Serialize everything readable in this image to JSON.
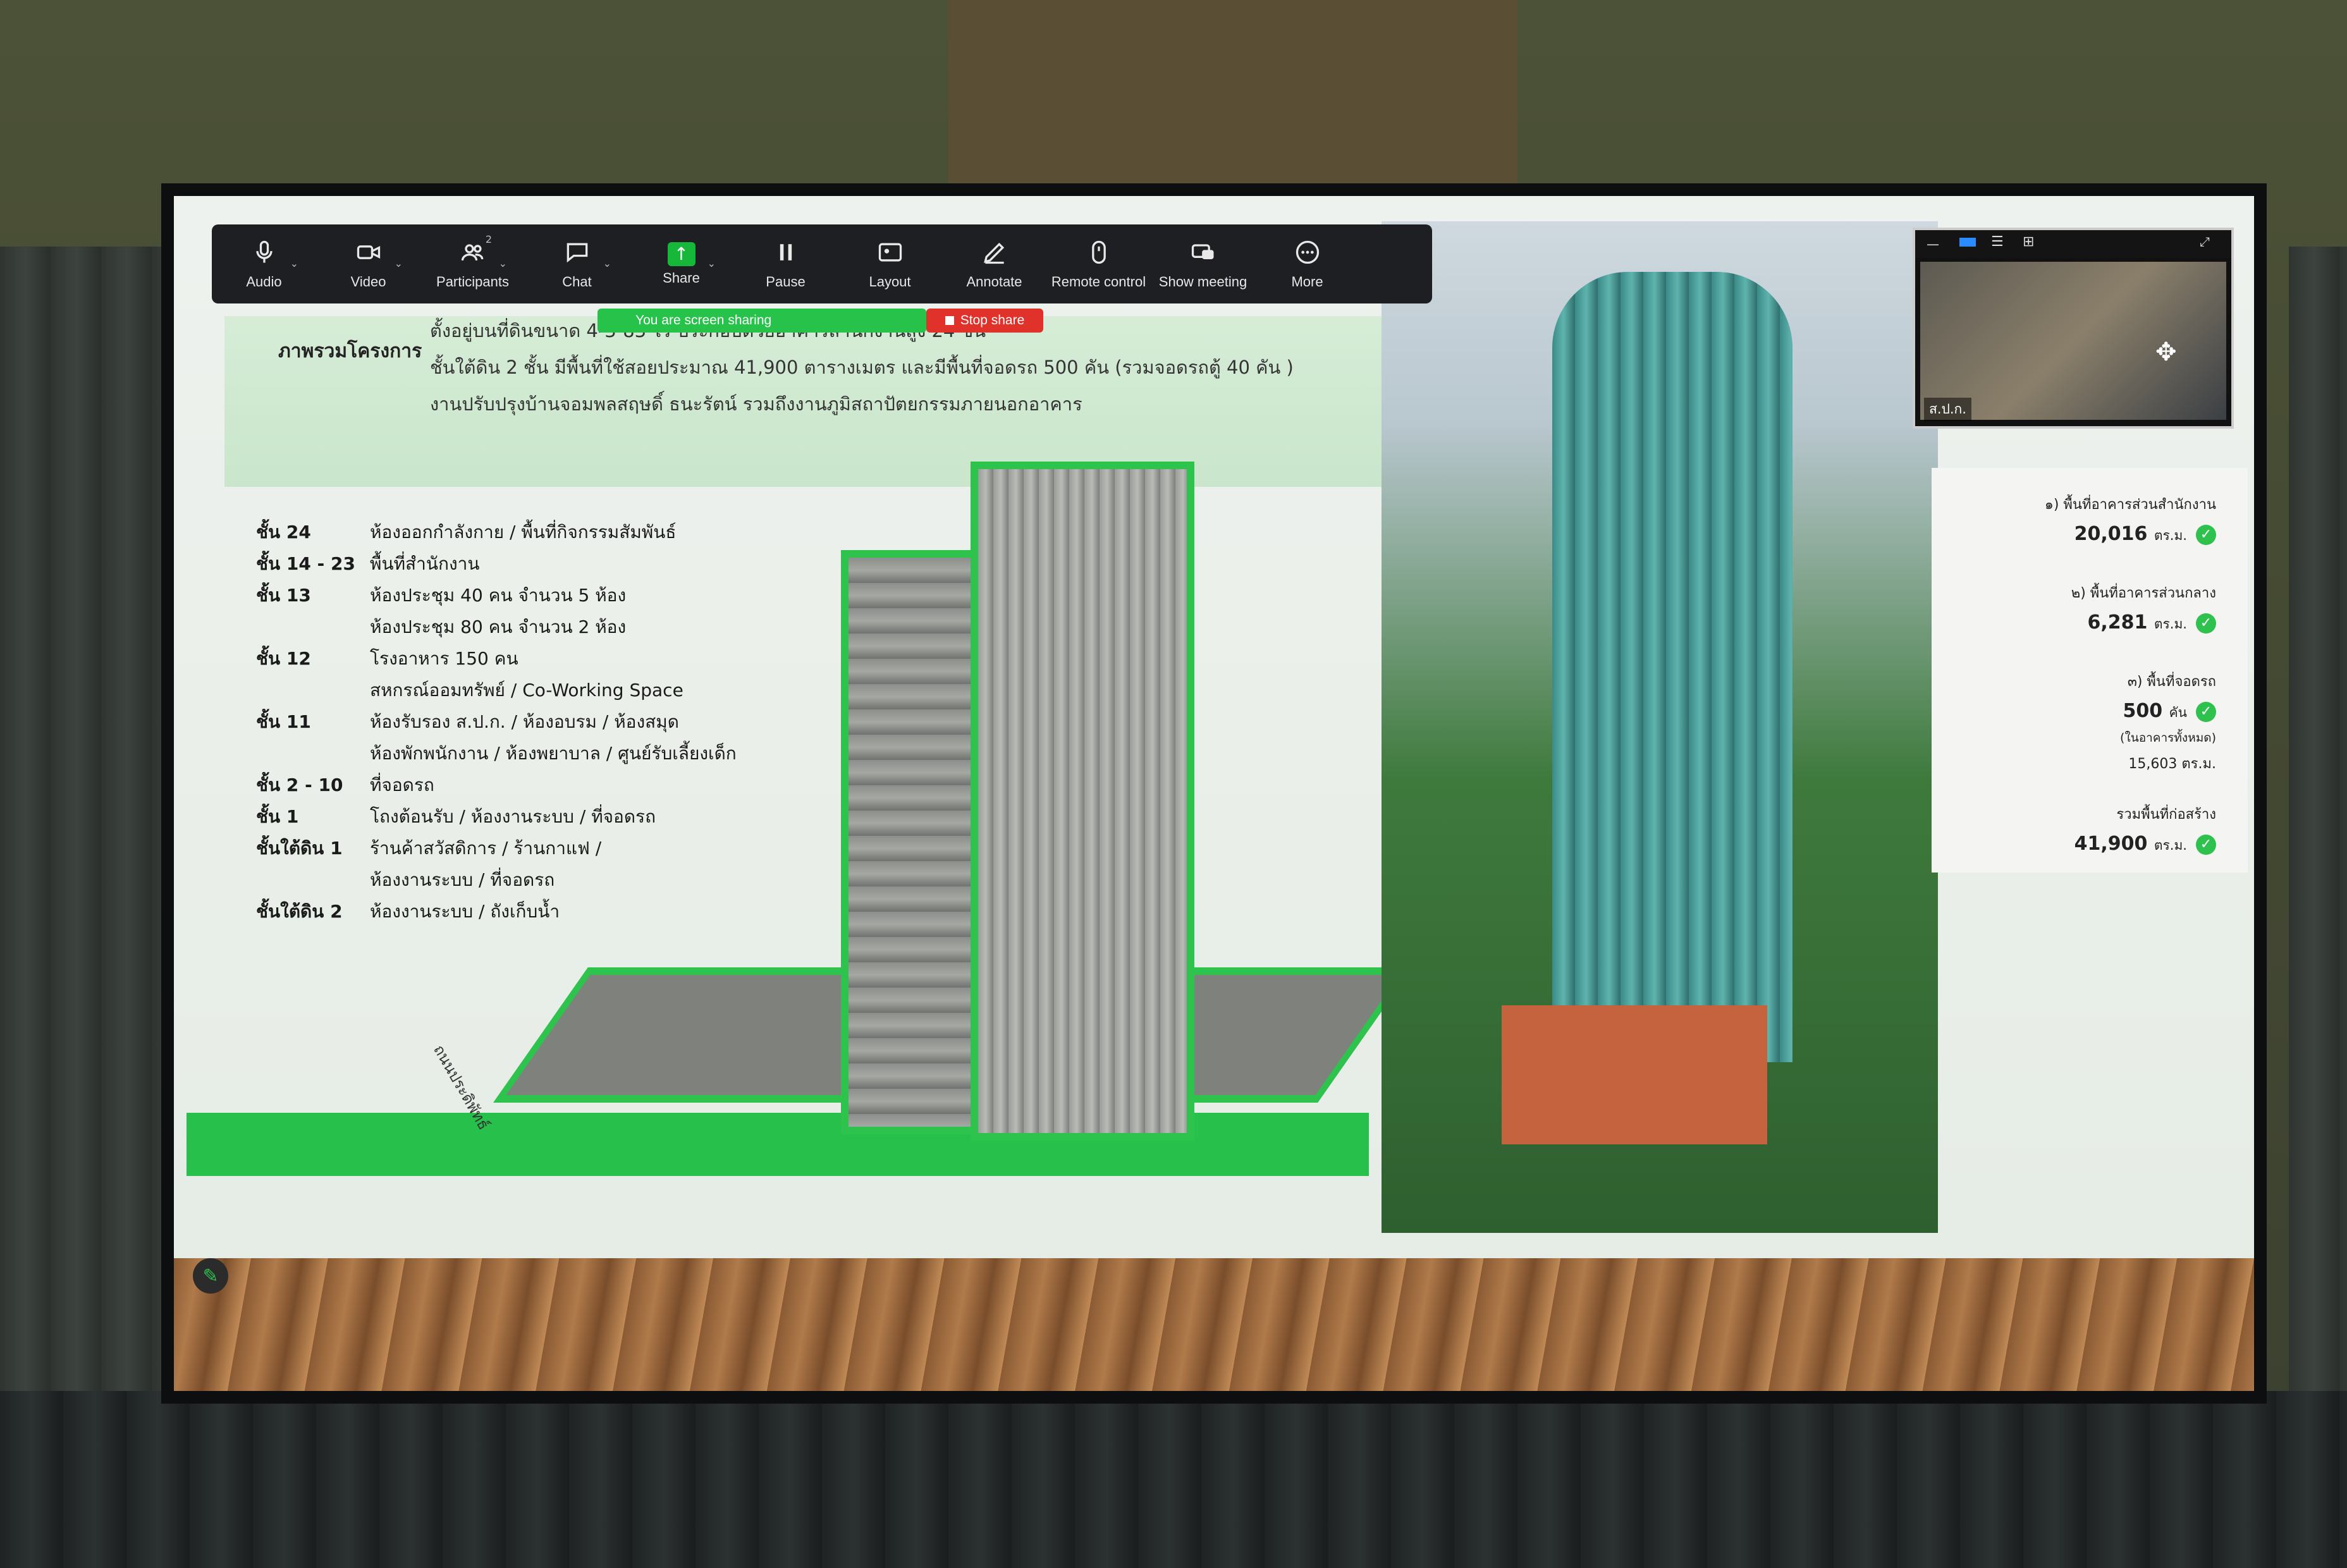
{
  "toolbar": {
    "items": [
      {
        "label": "Audio",
        "icon": "microphone-icon"
      },
      {
        "label": "Video",
        "icon": "video-camera-icon"
      },
      {
        "label": "Participants",
        "icon": "participants-icon",
        "count": "2"
      },
      {
        "label": "Chat",
        "icon": "chat-bubble-icon"
      },
      {
        "label": "Share",
        "icon": "share-screen-icon"
      },
      {
        "label": "Pause",
        "icon": "pause-icon"
      },
      {
        "label": "Layout",
        "icon": "layout-icon"
      },
      {
        "label": "Annotate",
        "icon": "pencil-icon"
      },
      {
        "label": "Remote control",
        "icon": "mouse-icon"
      },
      {
        "label": "Show meeting",
        "icon": "show-meeting-icon"
      },
      {
        "label": "More",
        "icon": "more-dots-icon"
      }
    ]
  },
  "share_banner": {
    "status": "You are screen sharing",
    "stop_label": "Stop share",
    "accent": "#27c24a",
    "stop_color": "#e0312b"
  },
  "slide": {
    "overview_label": "ภาพรวมโครงการ",
    "overview_lines": [
      "ตั้งอยู่บนที่ดินขนาด 4-3-83 ไร่ ประกอบด้วยอาคารสำนักงานสูง 24 ชั้น",
      "ชั้นใต้ดิน 2 ชั้น มีพื้นที่ใช้สอยประมาณ 41,900 ตารางเมตร และมีพื้นที่จอดรถ 500 คัน (รวมจอดรถตู้ 40 คัน )",
      "งานปรับปรุงบ้านจอมพลสฤษดิ์ ธนะรัตน์ รวมถึงงานภูมิสถาปัตยกรรมภายนอกอาคาร"
    ],
    "floors": [
      {
        "floor": "ชั้น 24",
        "desc": "ห้องออกกำลังกาย / พื้นที่กิจกรรมสัมพันธ์"
      },
      {
        "floor": "ชั้น 14 - 23",
        "desc": "พื้นที่สำนักงาน"
      },
      {
        "floor": "ชั้น 13",
        "desc": "ห้องประชุม 40 คน จำนวน 5 ห้อง"
      },
      {
        "floor": "",
        "desc": "ห้องประชุม 80 คน จำนวน 2 ห้อง"
      },
      {
        "floor": "ชั้น 12",
        "desc": "โรงอาหาร  150 คน"
      },
      {
        "floor": "",
        "desc": "สหกรณ์ออมทรัพย์ / Co-Working Space"
      },
      {
        "floor": "ชั้น 11",
        "desc": "ห้องรับรอง ส.ป.ก. / ห้องอบรม / ห้องสมุด"
      },
      {
        "floor": "",
        "desc": "ห้องพักพนักงาน / ห้องพยาบาล / ศูนย์รับเลี้ยงเด็ก"
      },
      {
        "floor": "ชั้น 2 - 10",
        "desc": "ที่จอดรถ"
      },
      {
        "floor": "ชั้น 1",
        "desc": "โถงต้อนรับ / ห้องงานระบบ / ที่จอดรถ"
      },
      {
        "floor": "ชั้นใต้ดิน 1",
        "desc": "ร้านค้าสวัสดิการ / ร้านกาแฟ  /"
      },
      {
        "floor": "",
        "desc": "ห้องงานระบบ / ที่จอดรถ"
      },
      {
        "floor": "ชั้นใต้ดิน 2",
        "desc": "ห้องงานระบบ / ถังเก็บน้ำ"
      }
    ],
    "road_label": "ถนนประดิพัทธ์"
  },
  "stats": [
    {
      "label": "๑) พื้นที่อาคารส่วนสำนักงาน",
      "value": "20,016",
      "unit": "ตร.ม.",
      "sub": ""
    },
    {
      "label": "๒) พื้นที่อาคารส่วนกลาง",
      "value": "6,281",
      "unit": "ตร.ม.",
      "sub": ""
    },
    {
      "label": "๓) พื้นที่จอดรถ",
      "value": "500",
      "unit": "คัน",
      "sub": "(ในอาคารทั้งหมด)",
      "sub2": "15,603 ตร.ม."
    },
    {
      "label": "รวมพื้นที่ก่อสร้าง",
      "value": "41,900",
      "unit": "ตร.ม.",
      "sub": ""
    }
  ],
  "video": {
    "participant_name": "ส.ป.ก."
  }
}
